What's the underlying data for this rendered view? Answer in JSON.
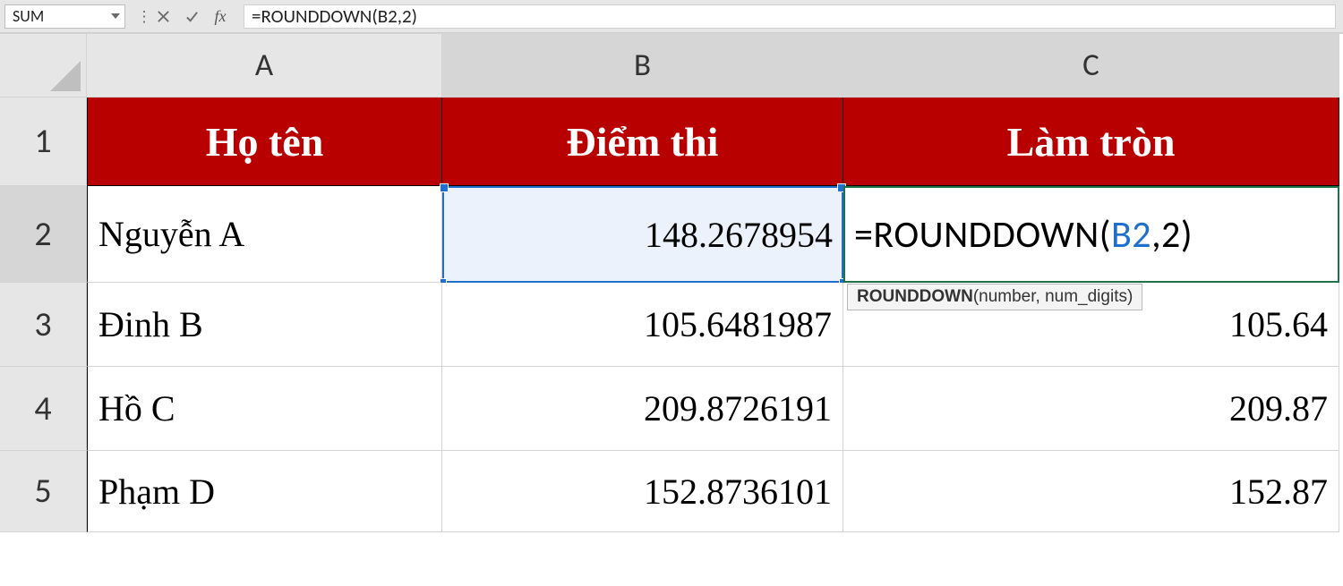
{
  "formula_bar": {
    "name_box": "SUM",
    "formula": "=ROUNDDOWN(B2,2)"
  },
  "col_headers": [
    "A",
    "B",
    "C"
  ],
  "row_headers": [
    "1",
    "2",
    "3",
    "4",
    "5"
  ],
  "table": {
    "headers": [
      "Họ tên",
      "Điểm thi",
      "Làm tròn"
    ],
    "rows": [
      {
        "name": "Nguyễn A",
        "score": "148.2678954",
        "round": ""
      },
      {
        "name": "Đinh B",
        "score": "105.6481987",
        "round": "105.64"
      },
      {
        "name": "Hồ C",
        "score": "209.8726191",
        "round": "209.87"
      },
      {
        "name": "Phạm D",
        "score": "152.8736101",
        "round": "152.87"
      }
    ]
  },
  "editing": {
    "prefix": "=ROUNDDOWN(",
    "ref": "B2",
    "suffix": ",2)",
    "tooltip_fn": "ROUNDDOWN",
    "tooltip_args": "(number, num_digits)"
  }
}
